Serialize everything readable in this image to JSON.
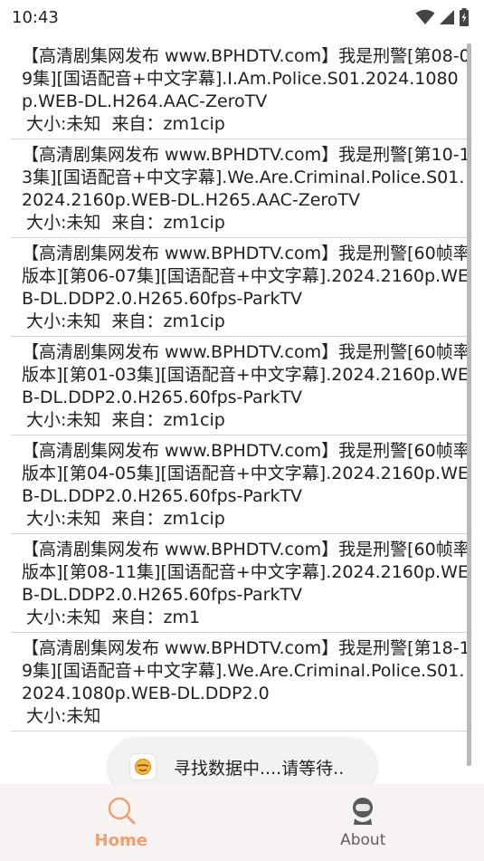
{
  "status_bar": {
    "time": "10:43",
    "icons": [
      "wifi-icon",
      "cellular-signal-icon",
      "battery-charging-icon"
    ]
  },
  "results": [
    {
      "title": "【高清剧集网发布 www.BPHDTV.com】我是刑警[第08-09集][国语配音+中文字幕].I.Am.Police.S01.2024.1080p.WEB-DL.H264.AAC-ZeroTV",
      "meta": "大小:未知  来自：zm1cip"
    },
    {
      "title": "【高清剧集网发布 www.BPHDTV.com】我是刑警[第10-13集][国语配音+中文字幕].We.Are.Criminal.Police.S01.2024.2160p.WEB-DL.H265.AAC-ZeroTV",
      "meta": "大小:未知  来自：zm1cip"
    },
    {
      "title": "【高清剧集网发布 www.BPHDTV.com】我是刑警[60帧率版本][第06-07集][国语配音+中文字幕].2024.2160p.WEB-DL.DDP2.0.H265.60fps-ParkTV",
      "meta": "大小:未知  来自：zm1cip"
    },
    {
      "title": "【高清剧集网发布 www.BPHDTV.com】我是刑警[60帧率版本][第01-03集][国语配音+中文字幕].2024.2160p.WEB-DL.DDP2.0.H265.60fps-ParkTV",
      "meta": "大小:未知  来自：zm1cip"
    },
    {
      "title": "【高清剧集网发布 www.BPHDTV.com】我是刑警[60帧率版本][第04-05集][国语配音+中文字幕].2024.2160p.WEB-DL.DDP2.0.H265.60fps-ParkTV",
      "meta": "大小:未知  来自：zm1cip"
    },
    {
      "title": "【高清剧集网发布 www.BPHDTV.com】我是刑警[60帧率版本][第08-11集][国语配音+中文字幕].2024.2160p.WEB-DL.DDP2.0.H265.60fps-ParkTV",
      "meta": "大小:未知  来自：zm1"
    },
    {
      "title": "【高清剧集网发布 www.BPHDTV.com】我是刑警[第18-19集][国语配音+中文字幕].We.Are.Criminal.Police.S01.2024.1080p.WEB-DL.DDP2.0",
      "meta": "大小:未知"
    }
  ],
  "toast": {
    "text": "寻找数据中....请等待..",
    "icon": "app-emoji-icon"
  },
  "bottom_nav": {
    "home_label": "Home",
    "about_label": "About",
    "home_icon": "search-icon",
    "about_icon": "astronaut-icon"
  },
  "colors": {
    "accent": "#f0a070",
    "nav_background": "#f7f3f2",
    "divider": "#d4d4d4"
  }
}
